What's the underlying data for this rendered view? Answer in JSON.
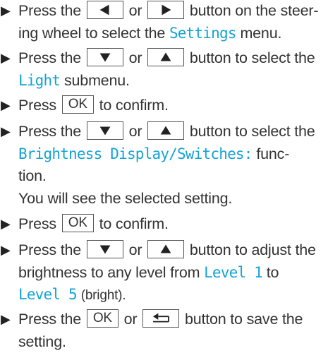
{
  "bullet": "▶",
  "accent_color": "#14a3d6",
  "steps": [
    {
      "t1": "Press the",
      "t2": "or",
      "t3": "button on the steer-",
      "t4": "ing wheel to select the",
      "m1": "Settings",
      "t5": "menu."
    },
    {
      "t1": "Press the",
      "t2": "or",
      "t3": "button to select the",
      "m1": "Light",
      "t4": "submenu."
    },
    {
      "t1": "Press",
      "k1": "OK",
      "t2": "to confirm."
    },
    {
      "t1": "Press the",
      "t2": "or",
      "t3": "button to select the",
      "m1": "Brightness Display/Switches:",
      "t4": "func-",
      "t5": "tion.",
      "t6": "You will see the selected setting."
    },
    {
      "t1": "Press",
      "k1": "OK",
      "t2": "to confirm."
    },
    {
      "t1": "Press the",
      "t2": "or",
      "t3": "button to adjust the",
      "t4": "brightness to any level from",
      "m1": "Level 1",
      "t5": "to",
      "m2": "Level 5",
      "t6": "(bright)."
    },
    {
      "t1": "Press the",
      "k1": "OK",
      "t2": "or",
      "t3": "button to save the",
      "t4": "setting."
    }
  ],
  "icons": {
    "left": "arrow-left-icon",
    "right": "arrow-right-icon",
    "down": "arrow-down-icon",
    "up": "arrow-up-icon",
    "back": "back-icon"
  }
}
